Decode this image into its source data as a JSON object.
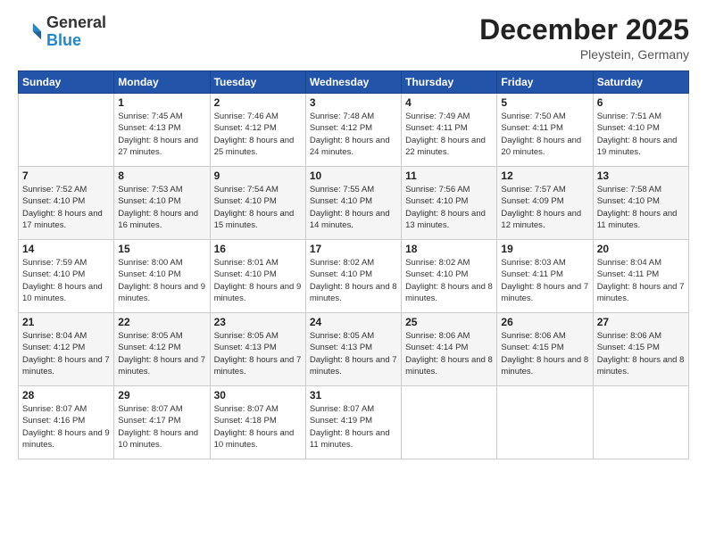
{
  "logo": {
    "general": "General",
    "blue": "Blue"
  },
  "header": {
    "month": "December 2025",
    "location": "Pleystein, Germany"
  },
  "weekdays": [
    "Sunday",
    "Monday",
    "Tuesday",
    "Wednesday",
    "Thursday",
    "Friday",
    "Saturday"
  ],
  "weeks": [
    [
      {
        "day": "",
        "sunrise": "",
        "sunset": "",
        "daylight": ""
      },
      {
        "day": "1",
        "sunrise": "Sunrise: 7:45 AM",
        "sunset": "Sunset: 4:13 PM",
        "daylight": "Daylight: 8 hours and 27 minutes."
      },
      {
        "day": "2",
        "sunrise": "Sunrise: 7:46 AM",
        "sunset": "Sunset: 4:12 PM",
        "daylight": "Daylight: 8 hours and 25 minutes."
      },
      {
        "day": "3",
        "sunrise": "Sunrise: 7:48 AM",
        "sunset": "Sunset: 4:12 PM",
        "daylight": "Daylight: 8 hours and 24 minutes."
      },
      {
        "day": "4",
        "sunrise": "Sunrise: 7:49 AM",
        "sunset": "Sunset: 4:11 PM",
        "daylight": "Daylight: 8 hours and 22 minutes."
      },
      {
        "day": "5",
        "sunrise": "Sunrise: 7:50 AM",
        "sunset": "Sunset: 4:11 PM",
        "daylight": "Daylight: 8 hours and 20 minutes."
      },
      {
        "day": "6",
        "sunrise": "Sunrise: 7:51 AM",
        "sunset": "Sunset: 4:10 PM",
        "daylight": "Daylight: 8 hours and 19 minutes."
      }
    ],
    [
      {
        "day": "7",
        "sunrise": "Sunrise: 7:52 AM",
        "sunset": "Sunset: 4:10 PM",
        "daylight": "Daylight: 8 hours and 17 minutes."
      },
      {
        "day": "8",
        "sunrise": "Sunrise: 7:53 AM",
        "sunset": "Sunset: 4:10 PM",
        "daylight": "Daylight: 8 hours and 16 minutes."
      },
      {
        "day": "9",
        "sunrise": "Sunrise: 7:54 AM",
        "sunset": "Sunset: 4:10 PM",
        "daylight": "Daylight: 8 hours and 15 minutes."
      },
      {
        "day": "10",
        "sunrise": "Sunrise: 7:55 AM",
        "sunset": "Sunset: 4:10 PM",
        "daylight": "Daylight: 8 hours and 14 minutes."
      },
      {
        "day": "11",
        "sunrise": "Sunrise: 7:56 AM",
        "sunset": "Sunset: 4:10 PM",
        "daylight": "Daylight: 8 hours and 13 minutes."
      },
      {
        "day": "12",
        "sunrise": "Sunrise: 7:57 AM",
        "sunset": "Sunset: 4:09 PM",
        "daylight": "Daylight: 8 hours and 12 minutes."
      },
      {
        "day": "13",
        "sunrise": "Sunrise: 7:58 AM",
        "sunset": "Sunset: 4:10 PM",
        "daylight": "Daylight: 8 hours and 11 minutes."
      }
    ],
    [
      {
        "day": "14",
        "sunrise": "Sunrise: 7:59 AM",
        "sunset": "Sunset: 4:10 PM",
        "daylight": "Daylight: 8 hours and 10 minutes."
      },
      {
        "day": "15",
        "sunrise": "Sunrise: 8:00 AM",
        "sunset": "Sunset: 4:10 PM",
        "daylight": "Daylight: 8 hours and 9 minutes."
      },
      {
        "day": "16",
        "sunrise": "Sunrise: 8:01 AM",
        "sunset": "Sunset: 4:10 PM",
        "daylight": "Daylight: 8 hours and 9 minutes."
      },
      {
        "day": "17",
        "sunrise": "Sunrise: 8:02 AM",
        "sunset": "Sunset: 4:10 PM",
        "daylight": "Daylight: 8 hours and 8 minutes."
      },
      {
        "day": "18",
        "sunrise": "Sunrise: 8:02 AM",
        "sunset": "Sunset: 4:10 PM",
        "daylight": "Daylight: 8 hours and 8 minutes."
      },
      {
        "day": "19",
        "sunrise": "Sunrise: 8:03 AM",
        "sunset": "Sunset: 4:11 PM",
        "daylight": "Daylight: 8 hours and 7 minutes."
      },
      {
        "day": "20",
        "sunrise": "Sunrise: 8:04 AM",
        "sunset": "Sunset: 4:11 PM",
        "daylight": "Daylight: 8 hours and 7 minutes."
      }
    ],
    [
      {
        "day": "21",
        "sunrise": "Sunrise: 8:04 AM",
        "sunset": "Sunset: 4:12 PM",
        "daylight": "Daylight: 8 hours and 7 minutes."
      },
      {
        "day": "22",
        "sunrise": "Sunrise: 8:05 AM",
        "sunset": "Sunset: 4:12 PM",
        "daylight": "Daylight: 8 hours and 7 minutes."
      },
      {
        "day": "23",
        "sunrise": "Sunrise: 8:05 AM",
        "sunset": "Sunset: 4:13 PM",
        "daylight": "Daylight: 8 hours and 7 minutes."
      },
      {
        "day": "24",
        "sunrise": "Sunrise: 8:05 AM",
        "sunset": "Sunset: 4:13 PM",
        "daylight": "Daylight: 8 hours and 7 minutes."
      },
      {
        "day": "25",
        "sunrise": "Sunrise: 8:06 AM",
        "sunset": "Sunset: 4:14 PM",
        "daylight": "Daylight: 8 hours and 8 minutes."
      },
      {
        "day": "26",
        "sunrise": "Sunrise: 8:06 AM",
        "sunset": "Sunset: 4:15 PM",
        "daylight": "Daylight: 8 hours and 8 minutes."
      },
      {
        "day": "27",
        "sunrise": "Sunrise: 8:06 AM",
        "sunset": "Sunset: 4:15 PM",
        "daylight": "Daylight: 8 hours and 8 minutes."
      }
    ],
    [
      {
        "day": "28",
        "sunrise": "Sunrise: 8:07 AM",
        "sunset": "Sunset: 4:16 PM",
        "daylight": "Daylight: 8 hours and 9 minutes."
      },
      {
        "day": "29",
        "sunrise": "Sunrise: 8:07 AM",
        "sunset": "Sunset: 4:17 PM",
        "daylight": "Daylight: 8 hours and 10 minutes."
      },
      {
        "day": "30",
        "sunrise": "Sunrise: 8:07 AM",
        "sunset": "Sunset: 4:18 PM",
        "daylight": "Daylight: 8 hours and 10 minutes."
      },
      {
        "day": "31",
        "sunrise": "Sunrise: 8:07 AM",
        "sunset": "Sunset: 4:19 PM",
        "daylight": "Daylight: 8 hours and 11 minutes."
      },
      {
        "day": "",
        "sunrise": "",
        "sunset": "",
        "daylight": ""
      },
      {
        "day": "",
        "sunrise": "",
        "sunset": "",
        "daylight": ""
      },
      {
        "day": "",
        "sunrise": "",
        "sunset": "",
        "daylight": ""
      }
    ]
  ]
}
